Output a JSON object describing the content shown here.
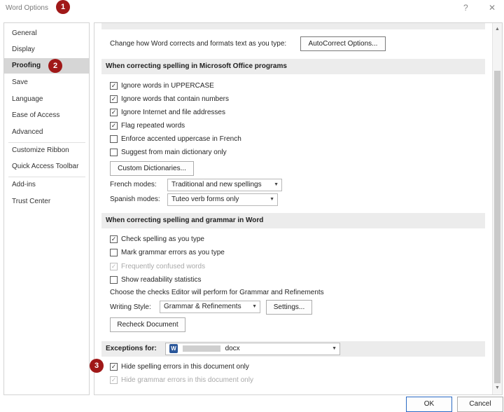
{
  "window": {
    "title": "Word Options",
    "help_glyph": "?",
    "close_glyph": "✕"
  },
  "callouts": [
    "1",
    "2",
    "3"
  ],
  "sidebar": {
    "items": [
      {
        "label": "General"
      },
      {
        "label": "Display"
      },
      {
        "label": "Proofing",
        "selected": true
      },
      {
        "label": "Save"
      },
      {
        "label": "Language"
      },
      {
        "label": "Ease of Access"
      },
      {
        "label": "Advanced"
      },
      {
        "label": "Customize Ribbon"
      },
      {
        "label": "Quick Access Toolbar"
      },
      {
        "label": "Add-ins"
      },
      {
        "label": "Trust Center"
      }
    ]
  },
  "autocorrect": {
    "text": "Change how Word corrects and formats text as you type:",
    "button": "AutoCorrect Options..."
  },
  "office_spelling": {
    "header": "When correcting spelling in Microsoft Office programs",
    "options": [
      {
        "label": "Ignore words in UPPERCASE",
        "checked": true
      },
      {
        "label": "Ignore words that contain numbers",
        "checked": true
      },
      {
        "label": "Ignore Internet and file addresses",
        "checked": true
      },
      {
        "label": "Flag repeated words",
        "checked": true
      },
      {
        "label": "Enforce accented uppercase in French",
        "checked": false
      },
      {
        "label": "Suggest from main dictionary only",
        "checked": false
      }
    ],
    "custom_dict_button": "Custom Dictionaries...",
    "french_label": "French modes:",
    "french_value": "Traditional and new spellings",
    "spanish_label": "Spanish modes:",
    "spanish_value": "Tuteo verb forms only"
  },
  "word_spelling": {
    "header": "When correcting spelling and grammar in Word",
    "options": [
      {
        "label": "Check spelling as you type",
        "checked": true,
        "disabled": false
      },
      {
        "label": "Mark grammar errors as you type",
        "checked": false,
        "disabled": false
      },
      {
        "label": "Frequently confused words",
        "checked": true,
        "disabled": true
      },
      {
        "label": "Show readability statistics",
        "checked": false,
        "disabled": false
      }
    ],
    "checks_text": "Choose the checks Editor will perform for Grammar and Refinements",
    "writing_style_label": "Writing Style:",
    "writing_style_value": "Grammar & Refinements",
    "settings_button": "Settings...",
    "recheck_button": "Recheck Document"
  },
  "exceptions": {
    "label": "Exceptions for:",
    "doc_suffix": "docx",
    "options": [
      {
        "label": "Hide spelling errors in this document only",
        "checked": true,
        "disabled": false
      },
      {
        "label": "Hide grammar errors in this document only",
        "checked": true,
        "disabled": true
      }
    ]
  },
  "footer": {
    "ok": "OK",
    "cancel": "Cancel"
  },
  "colors": {
    "callout": "#a01818",
    "selected_nav": "#d6d6d6",
    "section_header": "#ececec",
    "word_blue": "#2b579a"
  }
}
